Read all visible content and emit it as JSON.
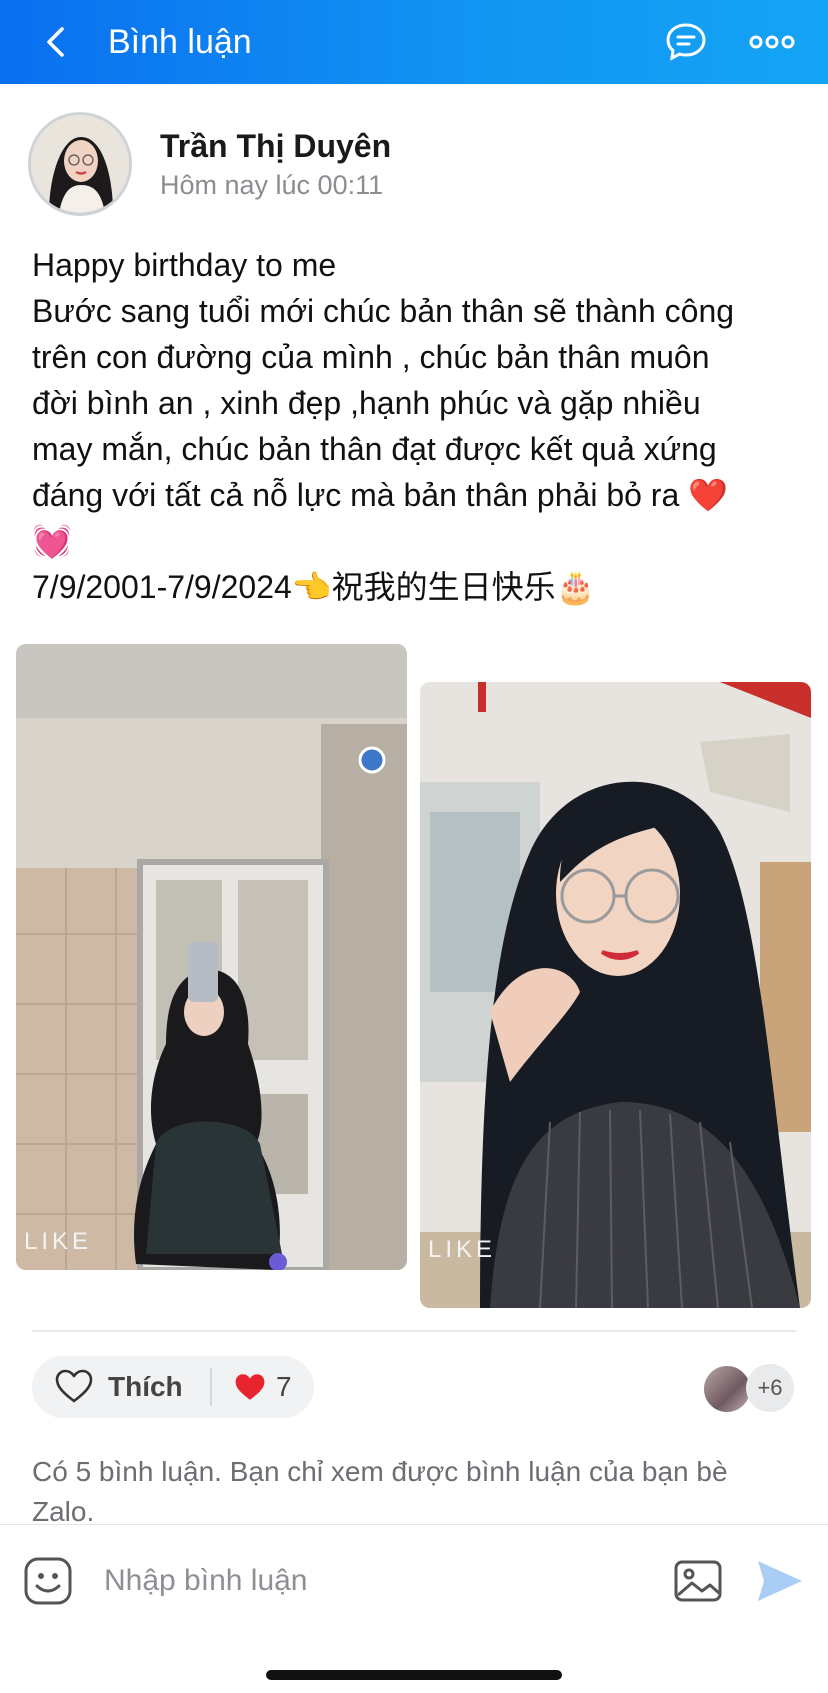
{
  "header": {
    "title": "Bình luận",
    "background_color": "#1296f2",
    "icons": [
      "chevron-left-icon",
      "chat-bubble-icon",
      "more-horizontal-icon"
    ]
  },
  "post": {
    "author": "Trần Thị Duyên",
    "time": "Hôm nay lúc 00:11",
    "lines": [
      "Happy birthday to me",
      "Bước sang tuổi mới chúc bản thân sẽ thành công",
      "trên con đường của mình , chúc bản thân muôn",
      "đời bình an , xinh đẹp ,hạnh phúc và gặp nhiều",
      "may mắn, chúc bản thân đạt được kết quả xứng",
      "đáng với tất cả nỗ lực mà bản thân phải bỏ ra ❤️",
      "💓",
      "7/9/2001-7/9/2024👈祝我的生日快乐🎂"
    ],
    "photo_watermarks": [
      "LIKE",
      "LIKE"
    ]
  },
  "actions": {
    "like_label": "Thích",
    "reaction_icon": "heart-icon",
    "reaction_count": "7",
    "likers_more": "+6"
  },
  "comments": {
    "notice": "Có 5 bình luận. Bạn chỉ xem được bình luận của bạn bè Zalo."
  },
  "composer": {
    "placeholder": "Nhập bình luận",
    "icons": [
      "sticker-icon",
      "image-icon",
      "send-icon"
    ],
    "send_color": "#a9cdf5"
  }
}
